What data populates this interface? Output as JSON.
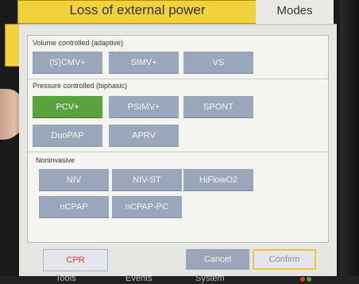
{
  "header": {
    "alarm_banner": "Loss of external power",
    "modes_tab": "Modes"
  },
  "sections": {
    "volume": {
      "label": "Volume controlled (adaptive)",
      "buttons": [
        "(S)CMV+",
        "SIMV+",
        "VS"
      ]
    },
    "pressure": {
      "label": "Pressure controlled (biphasic)",
      "buttons": [
        "PCV+",
        "PSIMV+",
        "SPONT",
        "DuoPAP",
        "APRV"
      ],
      "selected": "PCV+"
    },
    "noninvasive": {
      "label": "Noninvasive",
      "buttons": [
        "NIV",
        "NIV-ST",
        "HiFlowO2",
        "nCPAP",
        "nCPAP-PC"
      ]
    }
  },
  "footer": {
    "cpr": "CPR",
    "cancel": "Cancel",
    "confirm": "Confirm"
  },
  "bottom_nav": [
    "Tools",
    "Events",
    "System"
  ],
  "colors": {
    "alarm_yellow": "#f2d23a",
    "selected_green": "#5aa23d",
    "button_gray_blue": "#9aa6b9",
    "cpr_red": "#d83a2f",
    "confirm_border": "#f2c53d"
  }
}
